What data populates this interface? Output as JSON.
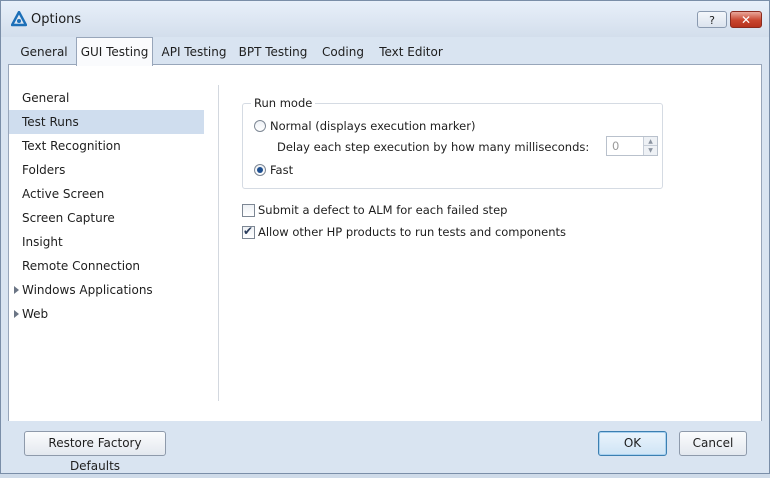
{
  "window": {
    "title": "Options",
    "help_label": "?",
    "close_label": "✕"
  },
  "tabs": [
    {
      "label": "General"
    },
    {
      "label": "GUI Testing",
      "active": true
    },
    {
      "label": "API Testing"
    },
    {
      "label": "BPT Testing"
    },
    {
      "label": "Coding"
    },
    {
      "label": "Text Editor"
    }
  ],
  "sidebar": {
    "items": [
      {
        "label": "General"
      },
      {
        "label": "Test Runs",
        "selected": true
      },
      {
        "label": "Text Recognition"
      },
      {
        "label": "Folders"
      },
      {
        "label": "Active Screen"
      },
      {
        "label": "Screen Capture"
      },
      {
        "label": "Insight"
      },
      {
        "label": "Remote Connection"
      },
      {
        "label": "Windows Applications",
        "expandable": true
      },
      {
        "label": "Web",
        "expandable": true
      }
    ]
  },
  "run_mode": {
    "group_title": "Run mode",
    "normal_label": "Normal (displays execution marker)",
    "delay_label": "Delay each step execution by how many milliseconds:",
    "delay_value": "0",
    "fast_label": "Fast",
    "selected": "Fast"
  },
  "options": {
    "submit_defect_label": "Submit a defect to ALM for each failed step",
    "submit_defect_checked": false,
    "allow_hp_label": "Allow other HP products to run tests and components",
    "allow_hp_checked": true
  },
  "footer": {
    "restore_label": "Restore Factory Defaults",
    "ok_label": "OK",
    "cancel_label": "Cancel"
  },
  "colors": {
    "accent": "#1e4f8f",
    "selection": "#cfddee",
    "close": "#c9462f"
  }
}
